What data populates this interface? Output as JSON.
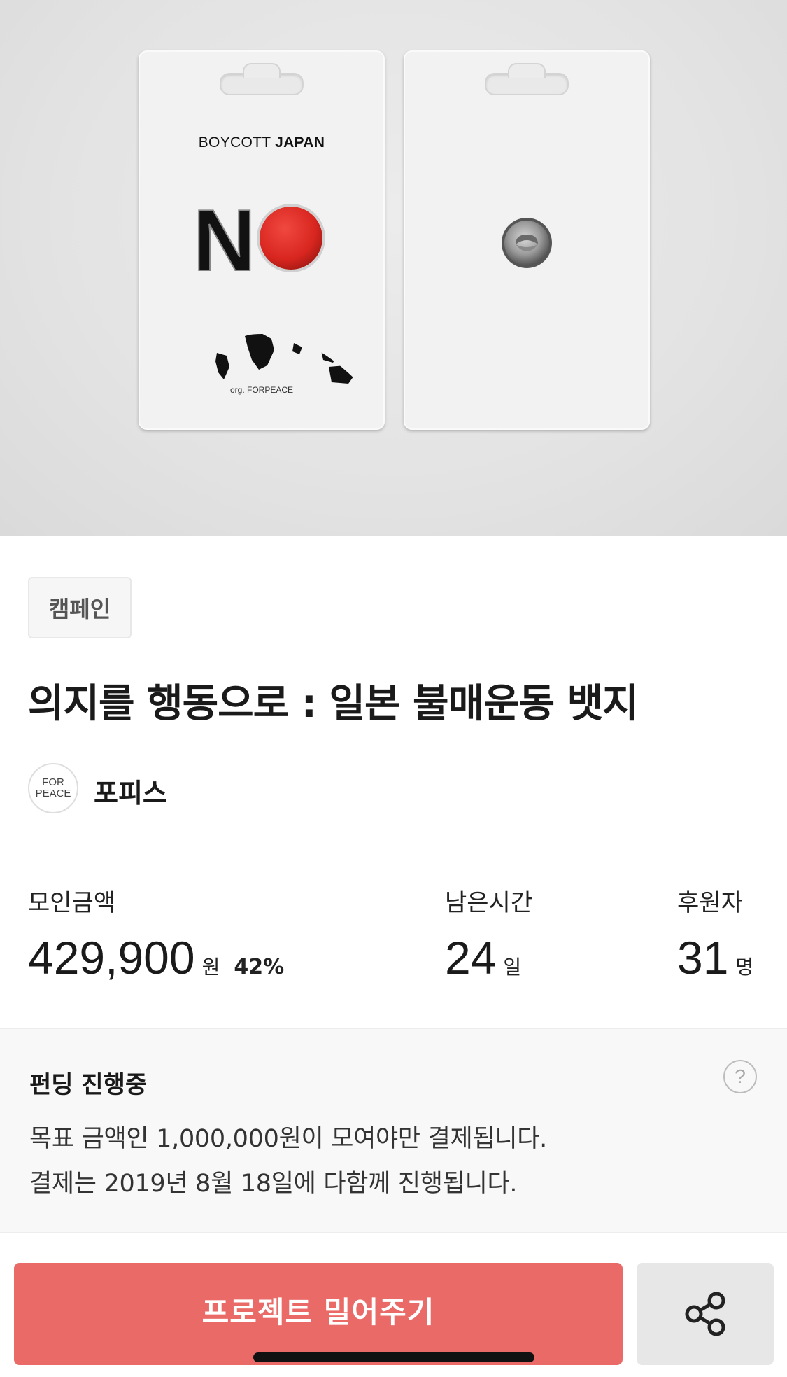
{
  "product_image": {
    "front_card": {
      "headline_regular": "BOYCOTT ",
      "headline_bold": "JAPAN",
      "logo_letter": "N",
      "footer": "org. FORPEACE"
    }
  },
  "category_tag": "캠페인",
  "title": "의지를 행동으로 : 일본 불매운동 뱃지",
  "creator": {
    "logo_line1": "FOR",
    "logo_line2": "PEACE",
    "name": "포피스"
  },
  "stats": {
    "raised": {
      "label": "모인금액",
      "value": "429,900",
      "unit": "원",
      "percent": "42%"
    },
    "remaining": {
      "label": "남은시간",
      "value": "24",
      "unit": "일"
    },
    "backers": {
      "label": "후원자",
      "value": "31",
      "unit": "명"
    }
  },
  "funding": {
    "title": "펀딩 진행중",
    "help_icon_text": "?",
    "line1": "목표 금액인 1,000,000원이 모여야만 결제됩니다.",
    "line2": "결제는 2019년 8월 18일에 다함께 진행됩니다."
  },
  "actions": {
    "push_label": "프로젝트 밀어주기",
    "share_icon": "share-icon"
  },
  "colors": {
    "accent": "#e96a66",
    "red_circle": "#d8261f"
  }
}
